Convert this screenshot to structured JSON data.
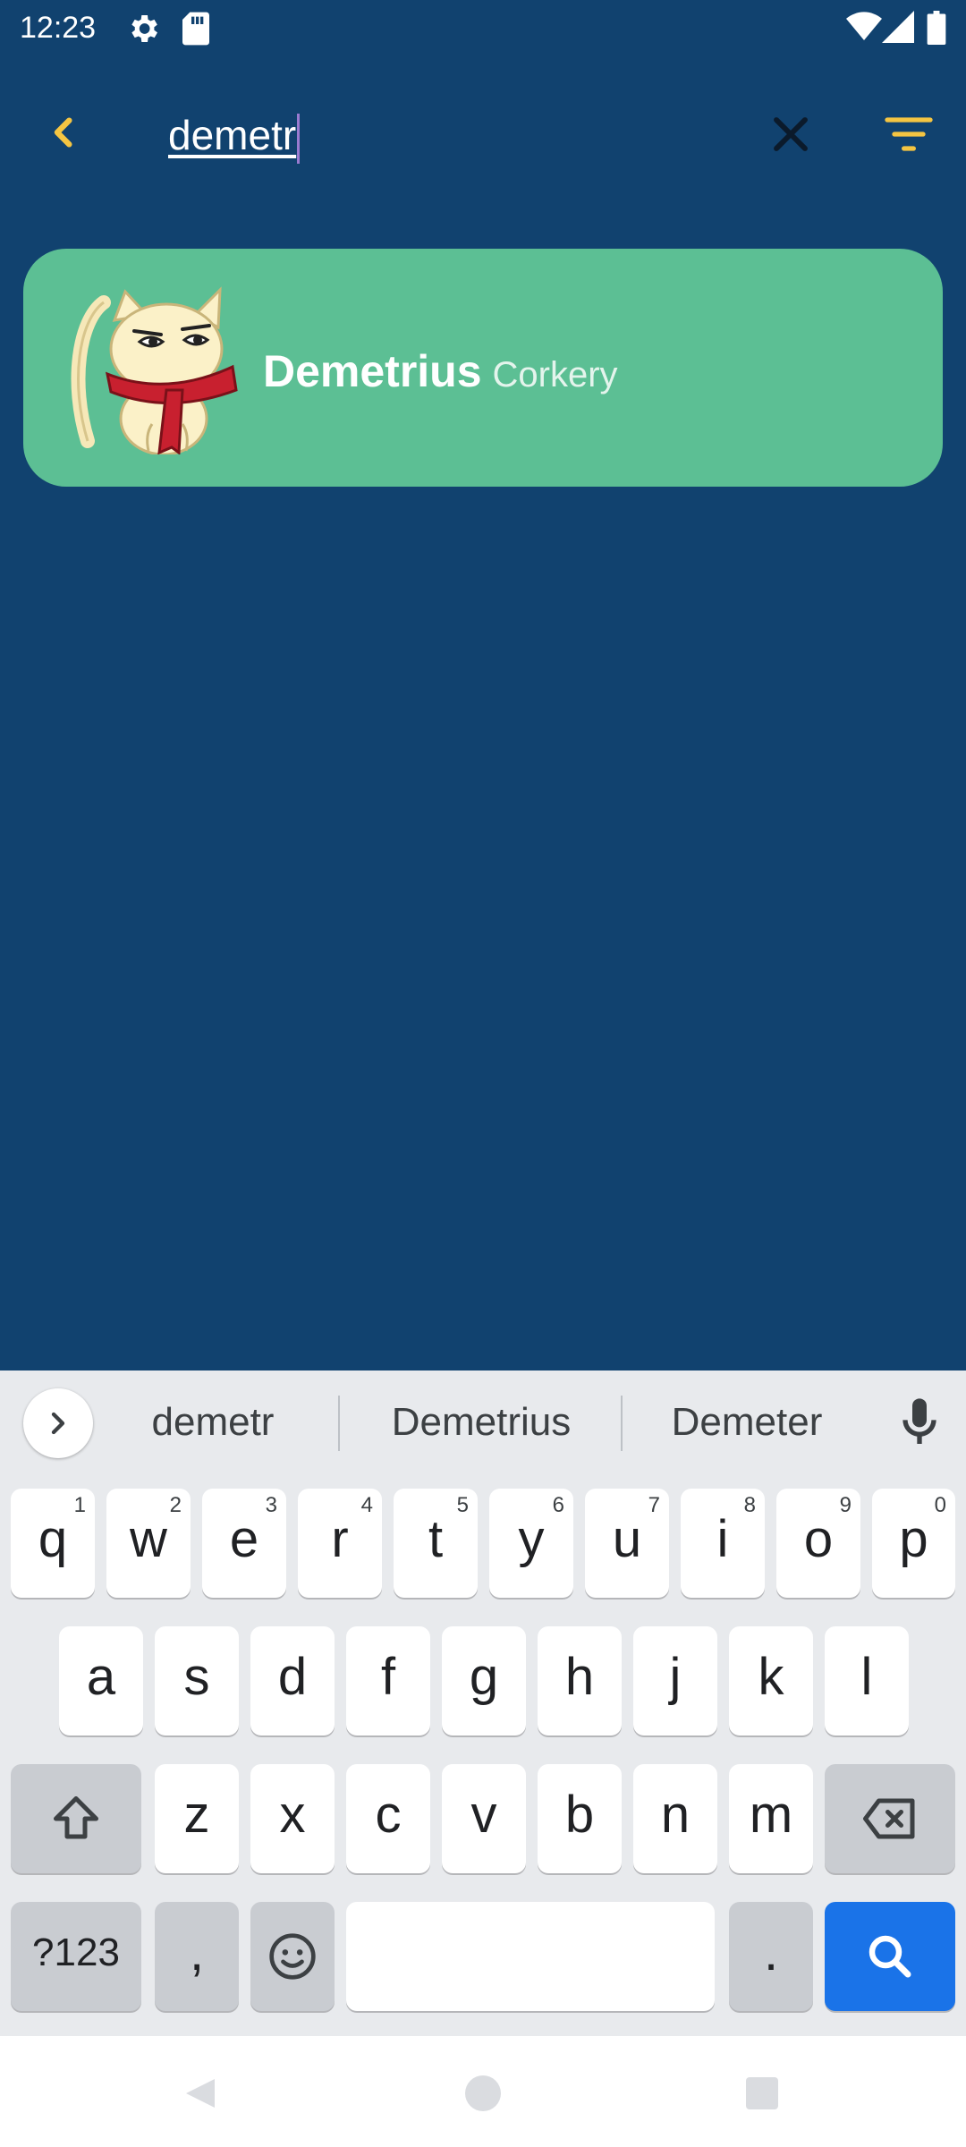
{
  "status_bar": {
    "time": "12:23",
    "left_icons": [
      "gear-icon",
      "sd-card-icon"
    ],
    "right_icons": [
      "wifi-icon",
      "cell-signal-icon",
      "battery-icon"
    ]
  },
  "toolbar": {
    "back_icon": "chevron-left-icon",
    "search_value": "demetr",
    "clear_icon": "close-icon",
    "filter_icon": "filter-icon"
  },
  "results": [
    {
      "first_name": "Demetrius",
      "last_name": "Corkery",
      "avatar": "cat-with-scarf"
    }
  ],
  "keyboard": {
    "suggestions": [
      "demetr",
      "Demetrius",
      "Demeter"
    ],
    "row1": [
      {
        "k": "q",
        "h": "1"
      },
      {
        "k": "w",
        "h": "2"
      },
      {
        "k": "e",
        "h": "3"
      },
      {
        "k": "r",
        "h": "4"
      },
      {
        "k": "t",
        "h": "5"
      },
      {
        "k": "y",
        "h": "6"
      },
      {
        "k": "u",
        "h": "7"
      },
      {
        "k": "i",
        "h": "8"
      },
      {
        "k": "o",
        "h": "9"
      },
      {
        "k": "p",
        "h": "0"
      }
    ],
    "row2": [
      "a",
      "s",
      "d",
      "f",
      "g",
      "h",
      "j",
      "k",
      "l"
    ],
    "row3": [
      "z",
      "x",
      "c",
      "v",
      "b",
      "n",
      "m"
    ],
    "symbols_label": "?123",
    "comma": ",",
    "period": "."
  },
  "colors": {
    "background": "#11426f",
    "accent": "#f5c542",
    "card": "#5cbf94",
    "keyboard_action": "#1a73e8"
  }
}
